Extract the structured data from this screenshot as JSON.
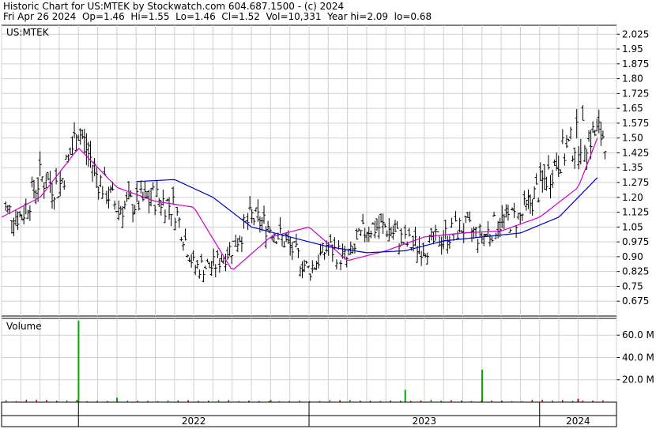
{
  "header": {
    "title_line": "Historic Chart for US:MTEK by Stockwatch.com 604.687.1500 - (c) 2024",
    "stats_line": "Fri Apr 26 2024  Op=1.46  Hi=1.55  Lo=1.46  Cl=1.52  Vol=10,331  Year hi=2.09  lo=0.68"
  },
  "colors": {
    "price": "#000000",
    "ma_short": "#cc00cc",
    "ma_long": "#0000cc",
    "vol_up": "#00aa00",
    "vol_down": "#cc0000",
    "grid": "#d0d0d0"
  },
  "chart_data": [
    {
      "type": "line",
      "panel": "price",
      "title": "US:MTEK",
      "ylim": [
        0.6,
        2.07
      ],
      "y_ticks": [
        "2.025",
        "1.95",
        "1.875",
        "1.80",
        "1.725",
        "1.65",
        "1.575",
        "1.50",
        "1.425",
        "1.35",
        "1.275",
        "1.20",
        "1.125",
        "1.05",
        "0.975",
        "0.90",
        "0.825",
        "0.75",
        "0.675"
      ],
      "x_labels": [
        "2022",
        "2023",
        "2024"
      ],
      "grid": true,
      "series": [
        {
          "style": "ohlc",
          "x": [
            "2021-09",
            "2021-10",
            "2021-11",
            "2021-12",
            "2022-01",
            "2022-02",
            "2022-03",
            "2022-04",
            "2022-05",
            "2022-06",
            "2022-07",
            "2022-08",
            "2022-09",
            "2022-10",
            "2022-11",
            "2022-12",
            "2023-01",
            "2023-02",
            "2023-03",
            "2023-04",
            "2023-05",
            "2023-06",
            "2023-07",
            "2023-08",
            "2023-09",
            "2023-10",
            "2023-11",
            "2023-12",
            "2024-01",
            "2024-02",
            "2024-03",
            "2024-04"
          ],
          "values": [
            1.15,
            1.1,
            1.3,
            1.25,
            1.55,
            1.3,
            1.15,
            1.17,
            1.2,
            1.15,
            0.85,
            0.85,
            0.95,
            1.1,
            1.05,
            0.95,
            0.83,
            0.95,
            0.88,
            1.05,
            1.05,
            0.97,
            0.95,
            1.0,
            1.05,
            1.0,
            1.08,
            1.1,
            1.25,
            1.4,
            1.5,
            1.52
          ]
        },
        {
          "style": "moving-average-short",
          "x": [
            "2021-09",
            "2021-11",
            "2022-01",
            "2022-03",
            "2022-05",
            "2022-07",
            "2022-09",
            "2022-11",
            "2023-01",
            "2023-03",
            "2023-05",
            "2023-07",
            "2023-09",
            "2023-11",
            "2024-01",
            "2024-03",
            "2024-04"
          ],
          "values": [
            1.1,
            1.2,
            1.45,
            1.25,
            1.18,
            1.15,
            0.83,
            1.0,
            1.05,
            0.88,
            0.93,
            1.0,
            1.02,
            1.03,
            1.1,
            1.25,
            1.5
          ]
        },
        {
          "style": "moving-average-long",
          "x": [
            "2022-04",
            "2022-06",
            "2022-08",
            "2022-10",
            "2022-12",
            "2023-02",
            "2023-04",
            "2023-06",
            "2023-08",
            "2023-10",
            "2023-12",
            "2024-02",
            "2024-04"
          ],
          "values": [
            1.28,
            1.29,
            1.2,
            1.05,
            1.0,
            0.95,
            0.92,
            0.93,
            0.98,
            1.0,
            1.02,
            1.1,
            1.3
          ]
        }
      ]
    },
    {
      "type": "bar",
      "panel": "volume",
      "title": "Volume",
      "ylim": [
        0,
        75
      ],
      "y_ticks": [
        "60.0 M",
        "40.0 M",
        "20.0 M"
      ],
      "spikes": [
        {
          "x": "2022-01",
          "value": 73
        },
        {
          "x": "2022-03",
          "value": 4
        },
        {
          "x": "2022-11",
          "value": 2
        },
        {
          "x": "2023-06",
          "value": 11
        },
        {
          "x": "2023-10",
          "value": 29
        },
        {
          "x": "2024-03",
          "value": 3
        }
      ]
    }
  ]
}
